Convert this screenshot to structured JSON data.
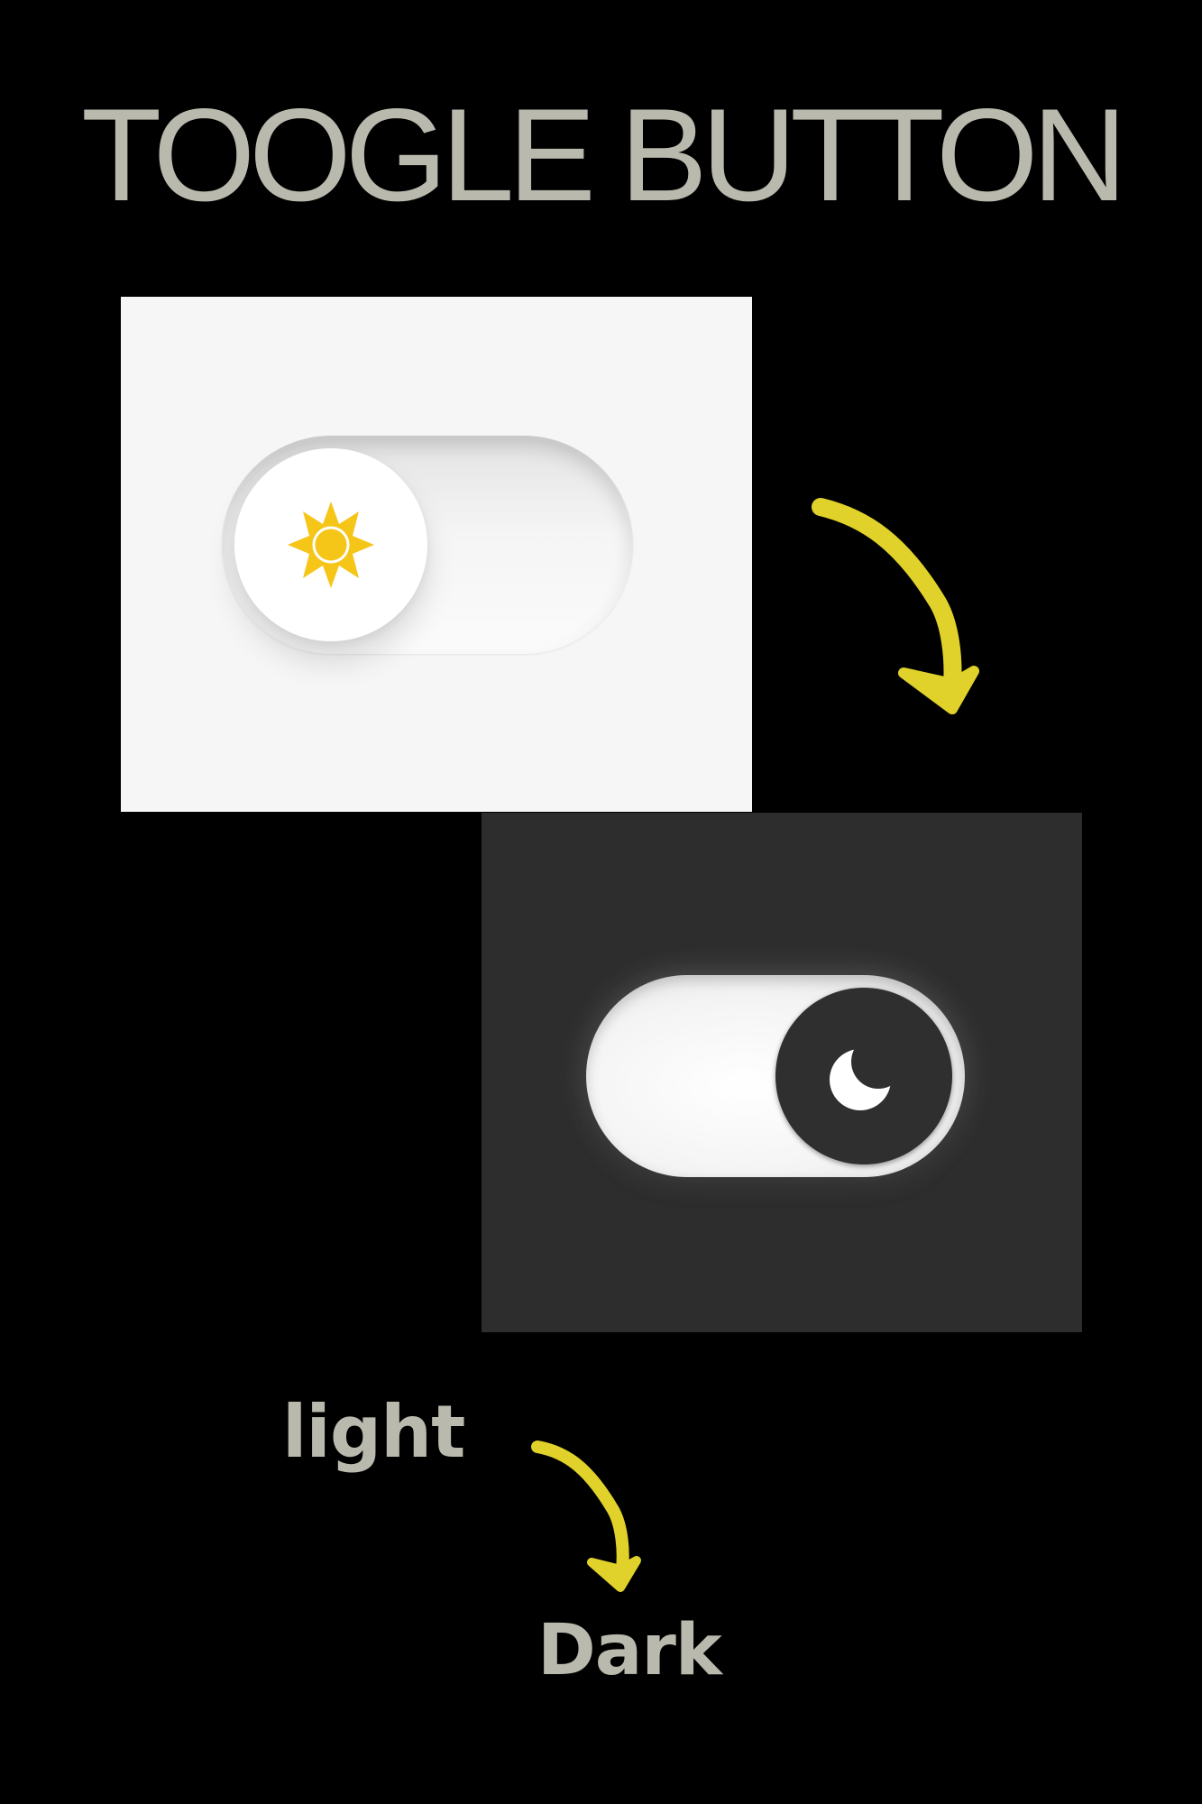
{
  "title": "TOOGLE BUTTON",
  "light_toggle": {
    "state": "off",
    "icon": "sun-icon",
    "panel_color": "#f6f6f6",
    "icon_color": "#f5c518"
  },
  "dark_toggle": {
    "state": "on",
    "icon": "moon-icon",
    "panel_color": "#2d2d2d",
    "knob_color": "#2f2f2f",
    "icon_color": "#ffffff"
  },
  "labels": {
    "light": "light",
    "dark": "Dark"
  },
  "colors": {
    "background": "#000000",
    "text": "#b9b9ad",
    "arrow": "#e0d22a"
  }
}
